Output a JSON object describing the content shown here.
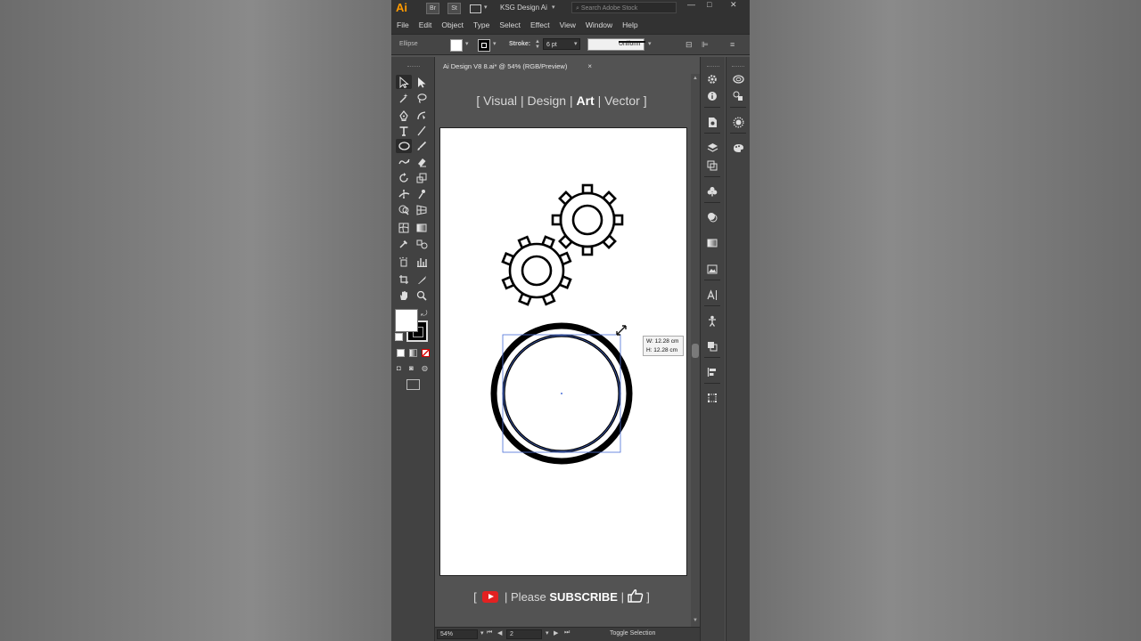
{
  "menubar": {
    "app_logo": "Ai",
    "bridge_label": "Br",
    "stock_label": "St",
    "workspace": "KSG Design Ai",
    "stock_search_placeholder": "Search Adobe Stock",
    "items": [
      "File",
      "Edit",
      "Object",
      "Type",
      "Select",
      "Effect",
      "View",
      "Window",
      "Help"
    ]
  },
  "control_bar": {
    "selection_label": "Ellipse",
    "stroke_label": "Stroke:",
    "stroke_weight": "6 pt",
    "profile_label": "Uniform"
  },
  "document": {
    "tab_title": "Ai Design V8 8.ai* @ 54% (RGB/Preview)",
    "close_glyph": "×"
  },
  "overlay": {
    "brand_open": "[ ",
    "brand_word1": "Visual",
    "brand_sep": " | ",
    "brand_word2": "Design",
    "brand_word3": "Art",
    "brand_word4": "Vector",
    "brand_close": " ]",
    "subscribe_open": "[",
    "subscribe_sep": "|",
    "subscribe_please": "Please",
    "subscribe_word": "SUBSCRIBE",
    "subscribe_close": "]"
  },
  "size_tooltip": {
    "width": "W: 12.28 cm",
    "height": "H: 12.28 cm"
  },
  "status_bar": {
    "zoom": "54%",
    "page": "2",
    "status_text": "Toggle Selection"
  },
  "colors": {
    "app_bg": "#535353",
    "panel_bg": "#424242",
    "menubar_bg": "#323232",
    "accent_ai": "#ff9a00",
    "youtube_red": "#e32121",
    "selection_blue": "#4a6fd8"
  }
}
